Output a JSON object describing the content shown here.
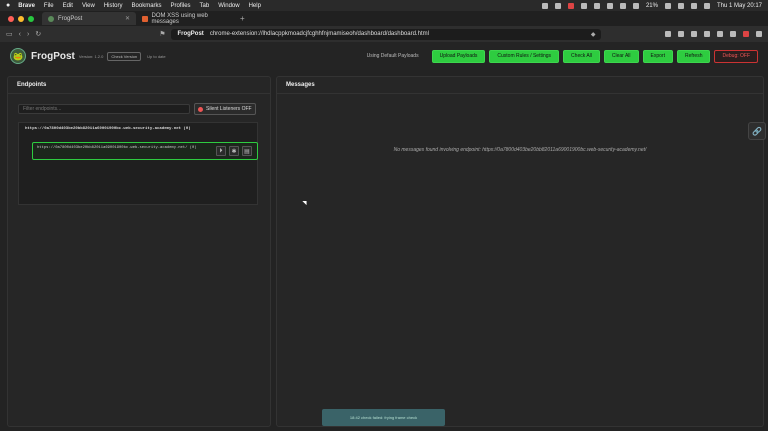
{
  "menubar": {
    "app": "Brave",
    "items": [
      "File",
      "Edit",
      "View",
      "History",
      "Bookmarks",
      "Profiles",
      "Tab",
      "Window",
      "Help"
    ],
    "battery": "21%",
    "clock": "Thu 1 May  20:17"
  },
  "tabs": [
    {
      "label": "FrogPost",
      "active": true
    },
    {
      "label": "DOM XSS using web messages",
      "active": false
    }
  ],
  "address": {
    "site": "FrogPost",
    "url": "chrome-extension://lhdlacppkmoadcjfcghhfnjmamiseoh/dashboard/dashboard.html"
  },
  "header": {
    "brand": "FrogPost",
    "version": "Version: 1.2.0",
    "check_version": "Check Version",
    "up_to_date": "Up to date",
    "payload_note": "Using Default Payloads",
    "buttons": {
      "upload": "Upload Payloads",
      "rules": "Custom Rules / Settings",
      "check_all": "Check All",
      "clear_all": "Clear All",
      "export": "Export",
      "refresh": "Refresh",
      "debug": "Debug: OFF"
    }
  },
  "endpoints": {
    "title": "Endpoints",
    "filter_placeholder": "Filter endpoints...",
    "silent_btn": "Silent Listeners OFF",
    "group_label": "https://0a7800d403be20bb82011a69001900bc.web-security-academy.net (0)",
    "item_url": "https://0a7800d403be20bb82011a69001900bc.web-security-academy.net/ (0)"
  },
  "messages": {
    "title": "Messages",
    "empty": "No messages found involving endpoint: https://0a7800d403be20bb82011a69001900bc.web-security-academy.net/"
  },
  "toast": "18:42 check failed: frying frame check"
}
